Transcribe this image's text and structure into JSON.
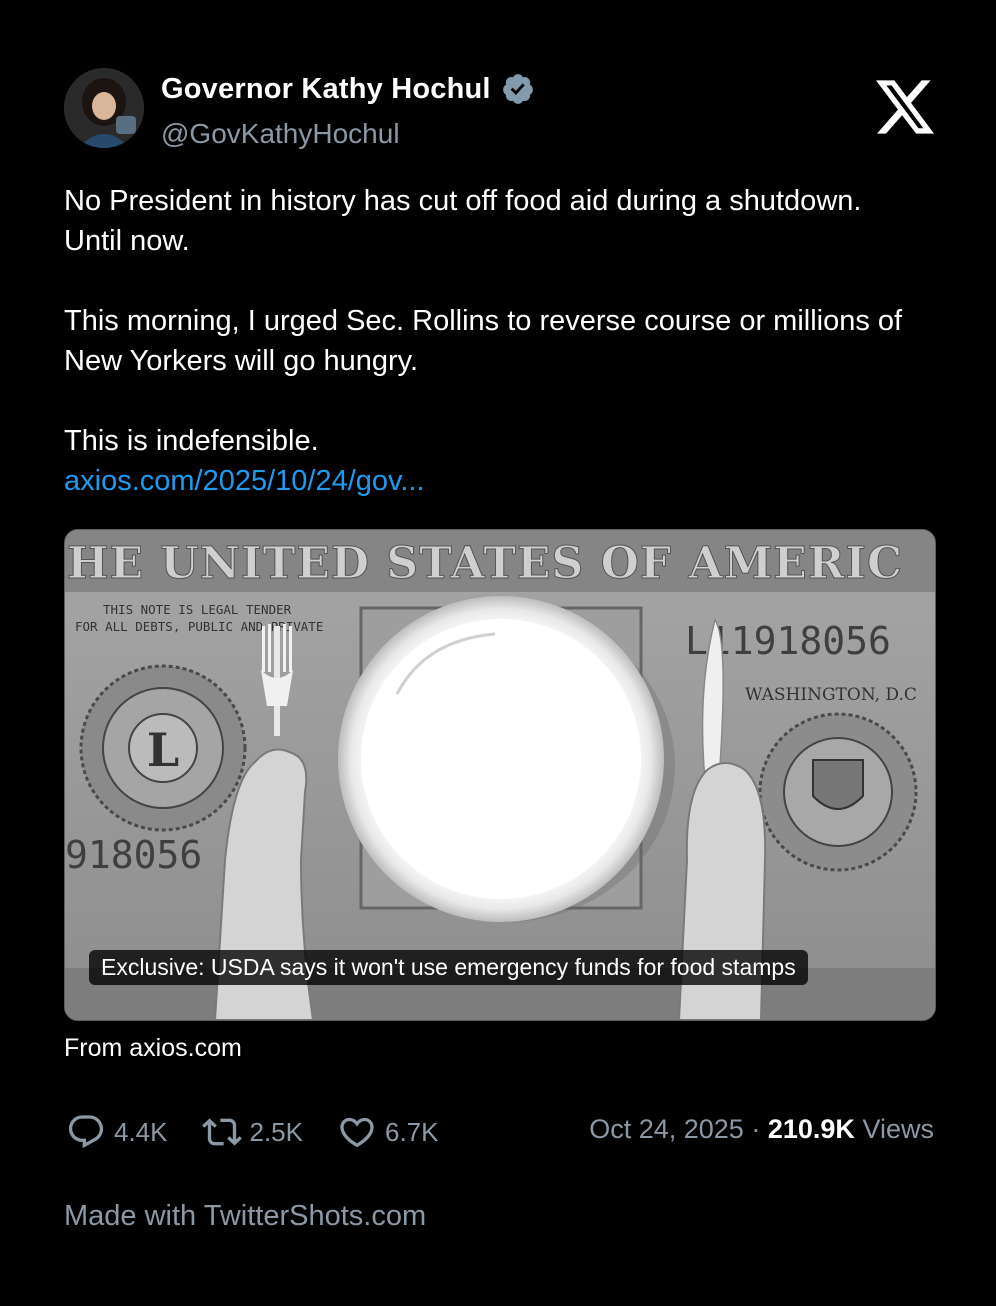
{
  "author": {
    "name": "Governor Kathy Hochul",
    "handle": "@GovKathyHochul",
    "verified": true
  },
  "tweet": {
    "paragraphs": [
      "No President in history has cut off food aid during a shutdown. Until now.",
      "This morning, I urged Sec. Rollins to reverse course or millions of New Yorkers will go hungry.",
      "This is indefensible."
    ],
    "link_text": "axios.com/2025/10/24/gov..."
  },
  "card": {
    "banner_text": "HE UNITED STATES OF AMERIC",
    "legal_tender": "THIS NOTE IS LEGAL TENDER",
    "legal_tender_2": "FOR ALL DEBTS, PUBLIC AND PRIVATE",
    "serial_right": "L11918056",
    "serial_left": "918056",
    "washington": "WASHINGTON, D.C",
    "seal_letter": "L",
    "caption": "Exclusive: USDA says it won't use emergency funds for food stamps",
    "source": "From axios.com"
  },
  "stats": {
    "replies": "4.4K",
    "retweets": "2.5K",
    "likes": "6.7K",
    "date": "Oct 24, 2025",
    "separator": "·",
    "views_count": "210.9K",
    "views_label": "Views"
  },
  "footer": "Made with TwitterShots.com",
  "colors": {
    "background": "#000000",
    "link": "#1d9bf0",
    "muted": "#8b98a5",
    "verified_badge": "#829aab"
  },
  "icons": [
    "avatar-photo",
    "verified-badge-icon",
    "x-logo-icon",
    "reply-icon",
    "retweet-icon",
    "like-icon"
  ]
}
